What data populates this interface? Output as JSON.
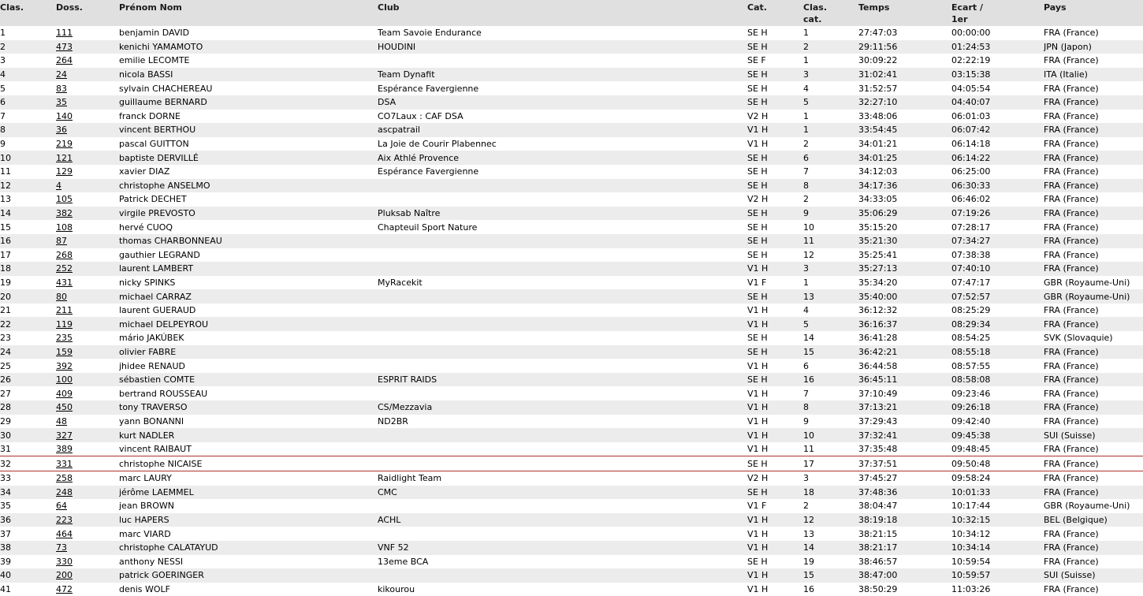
{
  "headers": {
    "clas": "Clas.",
    "doss": "Doss.",
    "nom": "Prénom Nom",
    "club": "Club",
    "cat": "Cat.",
    "clascat_1": "Clas.",
    "clascat_2": "cat.",
    "temps": "Temps",
    "ecart_1": "Ecart /",
    "ecart_2": "1er",
    "pays": "Pays"
  },
  "highlight_color": "#b03030",
  "rows": [
    [
      "1",
      "111",
      "benjamin DAVID",
      "Team Savoie Endurance",
      "SE H",
      "1",
      "27:47:03",
      "00:00:00",
      "FRA (France)"
    ],
    [
      "2",
      "473",
      "kenichi YAMAMOTO",
      "HOUDINI",
      "SE H",
      "2",
      "29:11:56",
      "01:24:53",
      "JPN (Japon)"
    ],
    [
      "3",
      "264",
      "emilie LECOMTE",
      "",
      "SE F",
      "1",
      "30:09:22",
      "02:22:19",
      "FRA (France)"
    ],
    [
      "4",
      "24",
      "nicola BASSI",
      "Team Dynafit",
      "SE H",
      "3",
      "31:02:41",
      "03:15:38",
      "ITA (Italie)"
    ],
    [
      "5",
      "83",
      "sylvain CHACHEREAU",
      "Espérance Favergienne",
      "SE H",
      "4",
      "31:52:57",
      "04:05:54",
      "FRA (France)"
    ],
    [
      "6",
      "35",
      "guillaume BERNARD",
      "DSA",
      "SE H",
      "5",
      "32:27:10",
      "04:40:07",
      "FRA (France)"
    ],
    [
      "7",
      "140",
      "franck DORNE",
      "CO7Laux : CAF DSA",
      "V2 H",
      "1",
      "33:48:06",
      "06:01:03",
      "FRA (France)"
    ],
    [
      "8",
      "36",
      "vincent BERTHOU",
      "ascpatrail",
      "V1 H",
      "1",
      "33:54:45",
      "06:07:42",
      "FRA (France)"
    ],
    [
      "9",
      "219",
      "pascal GUITTON",
      "La Joie de Courir Plabennec",
      "V1 H",
      "2",
      "34:01:21",
      "06:14:18",
      "FRA (France)"
    ],
    [
      "10",
      "121",
      "baptiste DERVILLÉ",
      "Aix Athlé Provence",
      "SE H",
      "6",
      "34:01:25",
      "06:14:22",
      "FRA (France)"
    ],
    [
      "11",
      "129",
      "xavier DIAZ",
      "Espérance Favergienne",
      "SE H",
      "7",
      "34:12:03",
      "06:25:00",
      "FRA (France)"
    ],
    [
      "12",
      "4",
      "christophe ANSELMO",
      "",
      "SE H",
      "8",
      "34:17:36",
      "06:30:33",
      "FRA (France)"
    ],
    [
      "13",
      "105",
      "Patrick DECHET",
      "",
      "V2 H",
      "2",
      "34:33:05",
      "06:46:02",
      "FRA (France)"
    ],
    [
      "14",
      "382",
      "virgile PREVOSTO",
      "Pluksab Naître",
      "SE H",
      "9",
      "35:06:29",
      "07:19:26",
      "FRA (France)"
    ],
    [
      "15",
      "108",
      "hervé CUOQ",
      "Chapteuil Sport Nature",
      "SE H",
      "10",
      "35:15:20",
      "07:28:17",
      "FRA (France)"
    ],
    [
      "16",
      "87",
      "thomas CHARBONNEAU",
      "",
      "SE H",
      "11",
      "35:21:30",
      "07:34:27",
      "FRA (France)"
    ],
    [
      "17",
      "268",
      "gauthier LEGRAND",
      "",
      "SE H",
      "12",
      "35:25:41",
      "07:38:38",
      "FRA (France)"
    ],
    [
      "18",
      "252",
      "laurent LAMBERT",
      "",
      "V1 H",
      "3",
      "35:27:13",
      "07:40:10",
      "FRA (France)"
    ],
    [
      "19",
      "431",
      "nicky SPINKS",
      "MyRacekit",
      "V1 F",
      "1",
      "35:34:20",
      "07:47:17",
      "GBR (Royaume-Uni)"
    ],
    [
      "20",
      "80",
      "michael CARRAZ",
      "",
      "SE H",
      "13",
      "35:40:00",
      "07:52:57",
      "GBR (Royaume-Uni)"
    ],
    [
      "21",
      "211",
      "laurent GUERAUD",
      "",
      "V1 H",
      "4",
      "36:12:32",
      "08:25:29",
      "FRA (France)"
    ],
    [
      "22",
      "119",
      "michael DELPEYROU",
      "",
      "V1 H",
      "5",
      "36:16:37",
      "08:29:34",
      "FRA (France)"
    ],
    [
      "23",
      "235",
      "mário JAKÚBEK",
      "",
      "SE H",
      "14",
      "36:41:28",
      "08:54:25",
      "SVK (Slovaquie)"
    ],
    [
      "24",
      "159",
      "olivier FABRE",
      "",
      "SE H",
      "15",
      "36:42:21",
      "08:55:18",
      "FRA (France)"
    ],
    [
      "25",
      "392",
      "jhidee RENAUD",
      "",
      "V1 H",
      "6",
      "36:44:58",
      "08:57:55",
      "FRA (France)"
    ],
    [
      "26",
      "100",
      "sébastien COMTE",
      "ESPRIT RAIDS",
      "SE H",
      "16",
      "36:45:11",
      "08:58:08",
      "FRA (France)"
    ],
    [
      "27",
      "409",
      "bertrand ROUSSEAU",
      "",
      "V1 H",
      "7",
      "37:10:49",
      "09:23:46",
      "FRA (France)"
    ],
    [
      "28",
      "450",
      "tony TRAVERSO",
      "CS/Mezzavia",
      "V1 H",
      "8",
      "37:13:21",
      "09:26:18",
      "FRA (France)"
    ],
    [
      "29",
      "48",
      "yann BONANNI",
      "ND2BR",
      "V1 H",
      "9",
      "37:29:43",
      "09:42:40",
      "FRA (France)"
    ],
    [
      "30",
      "327",
      "kurt NADLER",
      "",
      "V1 H",
      "10",
      "37:32:41",
      "09:45:38",
      "SUI (Suisse)"
    ],
    [
      "31",
      "389",
      "vincent RAIBAUT",
      "",
      "V1 H",
      "11",
      "37:35:48",
      "09:48:45",
      "FRA (France)"
    ],
    [
      "32",
      "331",
      "christophe NICAISE",
      "",
      "SE H",
      "17",
      "37:37:51",
      "09:50:48",
      "FRA (France)"
    ],
    [
      "33",
      "258",
      "marc LAURY",
      "Raidlight Team",
      "V2 H",
      "3",
      "37:45:27",
      "09:58:24",
      "FRA (France)"
    ],
    [
      "34",
      "248",
      "jérôme LAEMMEL",
      "CMC",
      "SE H",
      "18",
      "37:48:36",
      "10:01:33",
      "FRA (France)"
    ],
    [
      "35",
      "64",
      "jean BROWN",
      "",
      "V1 F",
      "2",
      "38:04:47",
      "10:17:44",
      "GBR (Royaume-Uni)"
    ],
    [
      "36",
      "223",
      "luc HAPERS",
      "ACHL",
      "V1 H",
      "12",
      "38:19:18",
      "10:32:15",
      "BEL (Belgique)"
    ],
    [
      "37",
      "464",
      "marc VIARD",
      "",
      "V1 H",
      "13",
      "38:21:15",
      "10:34:12",
      "FRA (France)"
    ],
    [
      "38",
      "73",
      "christophe CALATAYUD",
      "VNF 52",
      "V1 H",
      "14",
      "38:21:17",
      "10:34:14",
      "FRA (France)"
    ],
    [
      "39",
      "330",
      "anthony NESSI",
      "13eme BCA",
      "SE H",
      "19",
      "38:46:57",
      "10:59:54",
      "FRA (France)"
    ],
    [
      "40",
      "200",
      "patrick GOERINGER",
      "",
      "V1 H",
      "15",
      "38:47:00",
      "10:59:57",
      "SUI (Suisse)"
    ],
    [
      "41",
      "472",
      "denis WOLF",
      "kikourou",
      "V1 H",
      "16",
      "38:50:29",
      "11:03:26",
      "FRA (France)"
    ]
  ]
}
